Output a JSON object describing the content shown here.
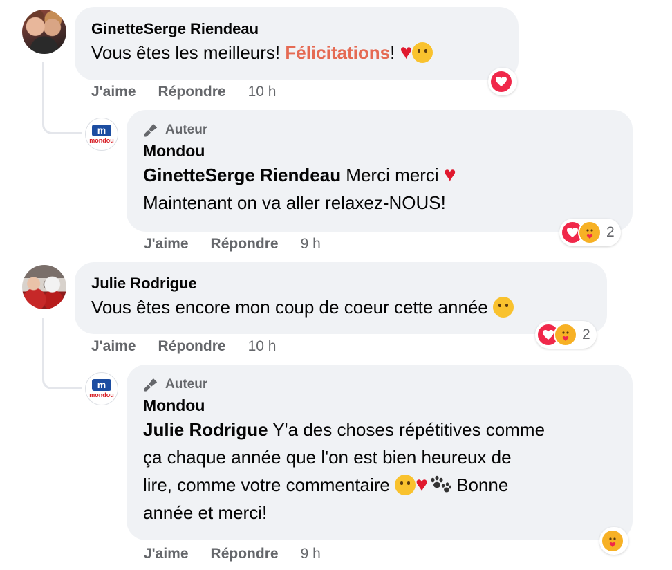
{
  "comments": [
    {
      "author": "GinetteSerge Riendeau",
      "text_before": "Vous êtes les meilleurs! ",
      "highlight": "Félicitations",
      "text_after": "! ",
      "emojis": [
        "heart",
        "rolling-laughing-face"
      ],
      "actions": {
        "like": "J'aime",
        "reply": "Répondre",
        "time": "10 h"
      },
      "reaction_count": ""
    },
    {
      "badge": "Auteur",
      "author": "Mondou",
      "mention": "GinetteSerge Riendeau",
      "text_line1": " Merci merci ",
      "text_line2": "Maintenant on va aller relaxez-NOUS!",
      "actions": {
        "like": "J'aime",
        "reply": "Répondre",
        "time": "9 h"
      },
      "reaction_count": "2"
    },
    {
      "author": "Julie Rodrigue",
      "text": "Vous êtes encore mon coup de coeur cette année ",
      "emojis": [
        "smiling-face-with-hearts"
      ],
      "actions": {
        "like": "J'aime",
        "reply": "Répondre",
        "time": "10 h"
      },
      "reaction_count": "2"
    },
    {
      "badge": "Auteur",
      "author": "Mondou",
      "mention": "Julie Rodrigue",
      "text_line1": " Y'a des choses répétitives comme",
      "text_line2": "ça chaque année que l'on est bien heureux de",
      "text_line3": "lire, comme votre commentaire ",
      "text_line3_end": " Bonne",
      "text_line4": "année et merci!",
      "emojis": [
        "winking-face",
        "heart",
        "paw-prints"
      ],
      "actions": {
        "like": "J'aime",
        "reply": "Répondre",
        "time": "9 h"
      },
      "reaction_count": ""
    }
  ],
  "brand_logo": {
    "letter": "m",
    "name": "mondou"
  },
  "colors": {
    "bubble": "#f0f2f5",
    "secondary_text": "#65676b",
    "love": "#f0284a",
    "care": "#f7b125",
    "highlight": "#e56a53"
  }
}
